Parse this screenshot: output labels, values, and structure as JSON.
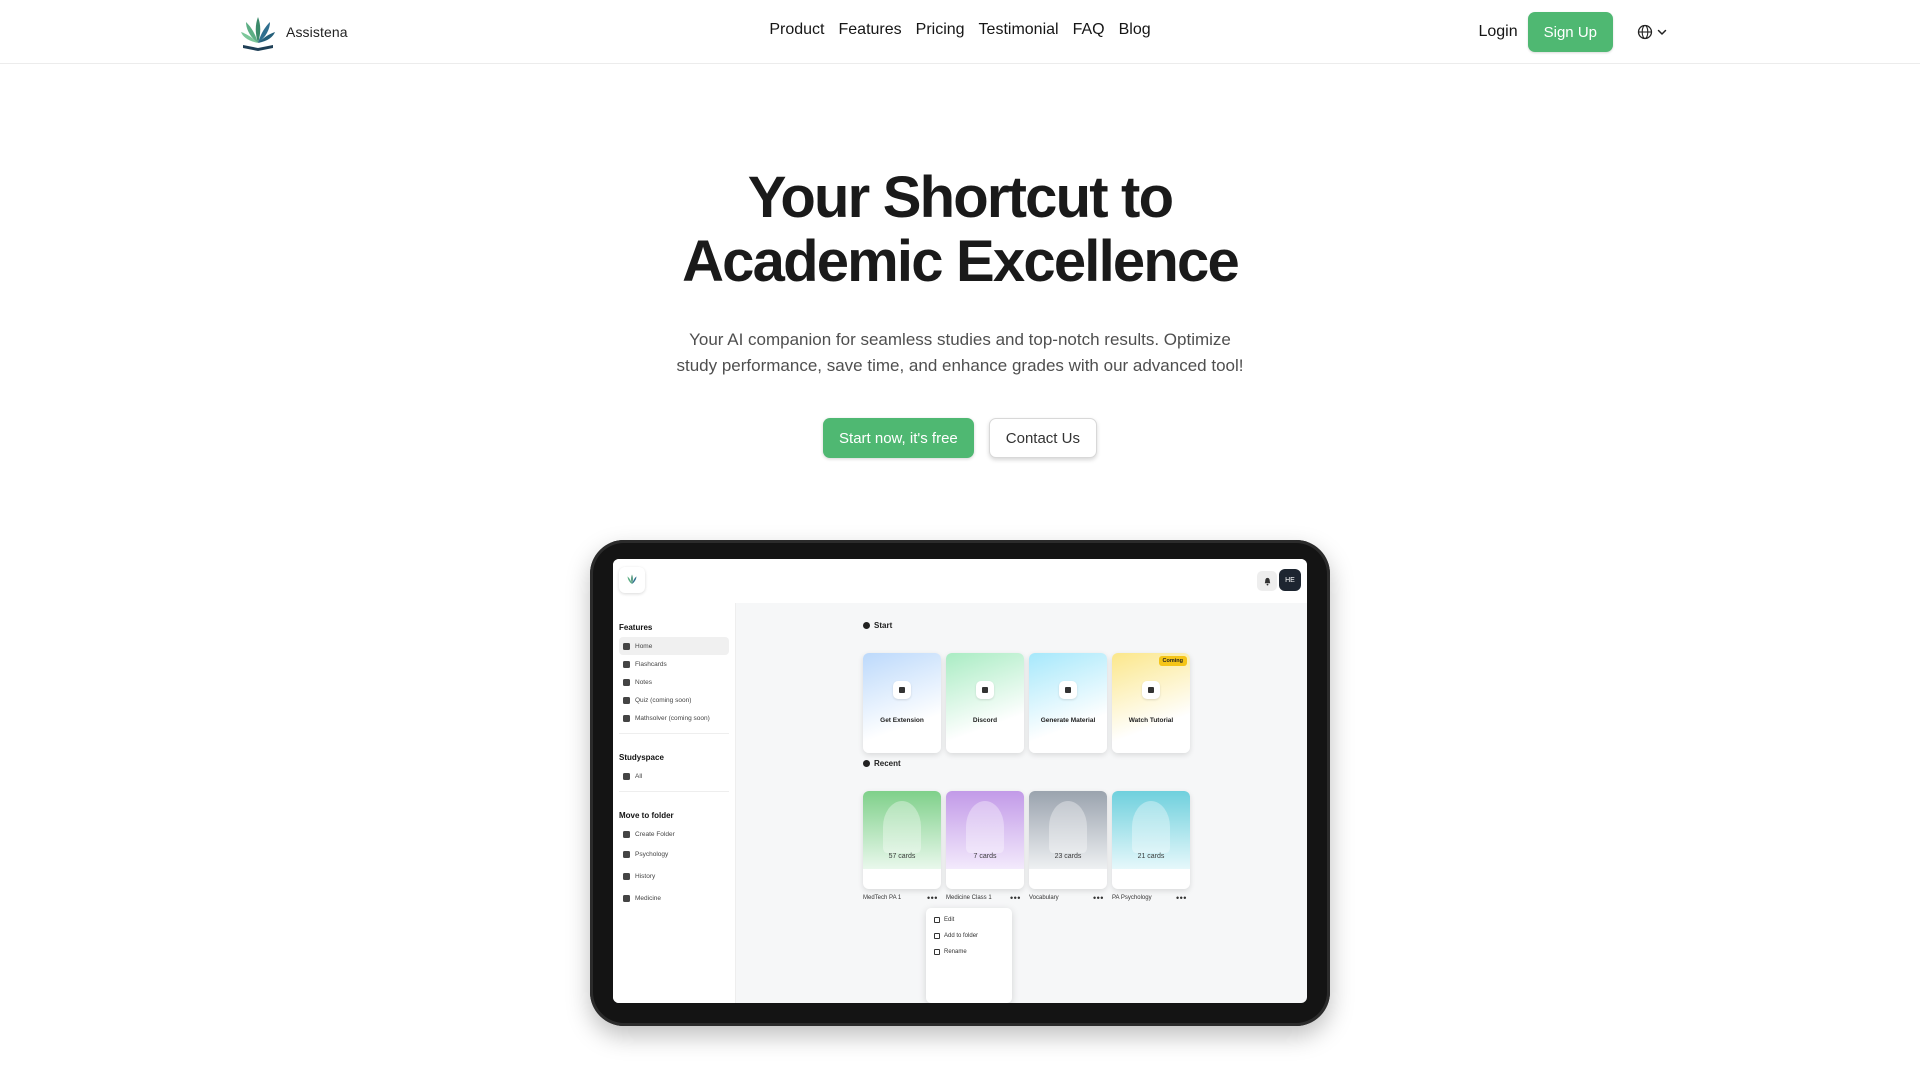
{
  "brand": {
    "name": "Assistena",
    "logo_icon": "leaf-logo-icon"
  },
  "nav": {
    "links": [
      "Product",
      "Features",
      "Pricing",
      "Testimonial",
      "FAQ",
      "Blog"
    ],
    "login": "Login",
    "signup": "Sign Up",
    "language_icon": "globe-icon"
  },
  "hero": {
    "title_line1": "Your Shortcut to",
    "title_line2": "Academic Excellence",
    "subtitle_line1": "Your AI companion for seamless studies and top-notch results. Optimize",
    "subtitle_line2": "study performance, save time, and enhance grades with our advanced tool!",
    "cta_primary": "Start now, it's free",
    "cta_secondary": "Contact Us"
  },
  "app": {
    "avatar": "HE",
    "sidebar": {
      "features_heading": "Features",
      "features": [
        "Home",
        "Flashcards",
        "Notes",
        "Quiz (coming soon)",
        "Mathsolver (coming soon)"
      ],
      "studyspace_heading": "Studyspace",
      "studyspace_items": [
        "All"
      ],
      "folder_heading": "Move to folder",
      "folders": [
        "Create Folder",
        "Psychology",
        "History",
        "Medicine"
      ]
    },
    "start_heading": "Start",
    "start_cards": [
      "Get Extension",
      "Discord",
      "Generate Material",
      "Watch Tutorial"
    ],
    "coming_badge": "Coming",
    "recent_heading": "Recent",
    "recent": [
      {
        "count": "57 cards",
        "name": "MedTech PA 1"
      },
      {
        "count": "7 cards",
        "name": "Medicine Class 1"
      },
      {
        "count": "23 cards",
        "name": "Vocabulary"
      },
      {
        "count": "21 cards",
        "name": "PA Psychology"
      }
    ],
    "context_menu": [
      "Edit",
      "Add to folder",
      "Rename"
    ],
    "colors": {
      "accent": "#4fb872",
      "card_blue": "#cfe4fb",
      "card_green": "#cdf3dc",
      "card_cyan": "#c9eefb",
      "card_yellow": "#fbf0b6",
      "recent_green": "#7fd08a",
      "recent_purple": "#c29ae8",
      "recent_gray": "#9aa3ae",
      "recent_teal": "#6fd0dd"
    }
  }
}
